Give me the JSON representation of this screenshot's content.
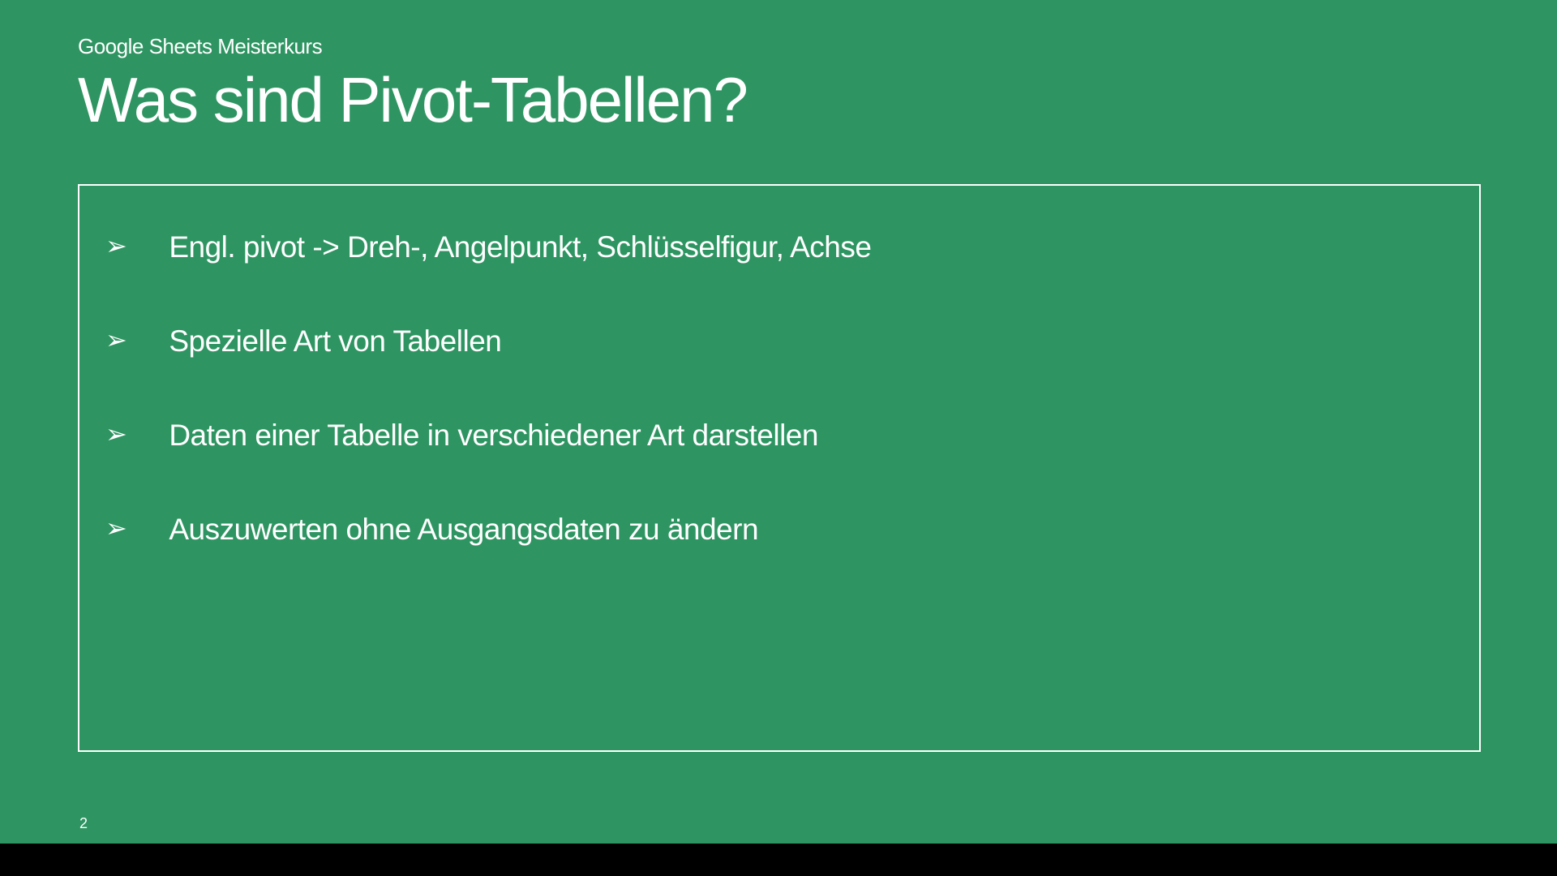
{
  "slide": {
    "subtitle": "Google Sheets Meisterkurs",
    "title": "Was sind Pivot-Tabellen?",
    "bullets": [
      "Engl. pivot -> Dreh-, Angelpunkt, Schlüsselfigur, Achse",
      "Spezielle Art von Tabellen",
      "Daten einer Tabelle in verschiedener Art darstellen",
      "Auszuwerten ohne Ausgangsdaten zu ändern"
    ],
    "page_number": "2",
    "bullet_glyph": "➢"
  }
}
